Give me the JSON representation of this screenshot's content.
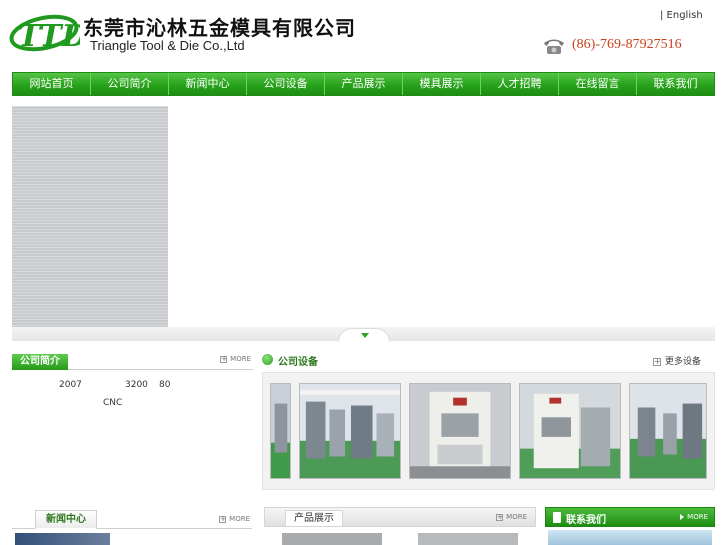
{
  "header": {
    "company_cn": "东莞市沁林五金模具有限公司",
    "company_en": "Triangle Tool & Die Co.,Ltd",
    "language_link": "| English",
    "phone": "(86)-769-87927516"
  },
  "nav": {
    "items": [
      "网站首页",
      "公司简介",
      "新闻中心",
      "公司设备",
      "产品展示",
      "模具展示",
      "人才招聘",
      "在线留言",
      "联系我们"
    ]
  },
  "about": {
    "title": "公司简介",
    "more": "MORE",
    "year": "2007",
    "area": "3200",
    "count": "80",
    "cnc": "CNC"
  },
  "equipment": {
    "title": "公司设备",
    "more": "更多设备"
  },
  "news": {
    "title": "新闻中心",
    "more": "MORE"
  },
  "products": {
    "title": "产品展示",
    "more": "MORE"
  },
  "contact": {
    "title": "联系我们",
    "more": "MORE"
  },
  "colors": {
    "nav_green": "#27a21b",
    "phone_red": "#c8401e",
    "accent_green": "#2f7a20"
  }
}
